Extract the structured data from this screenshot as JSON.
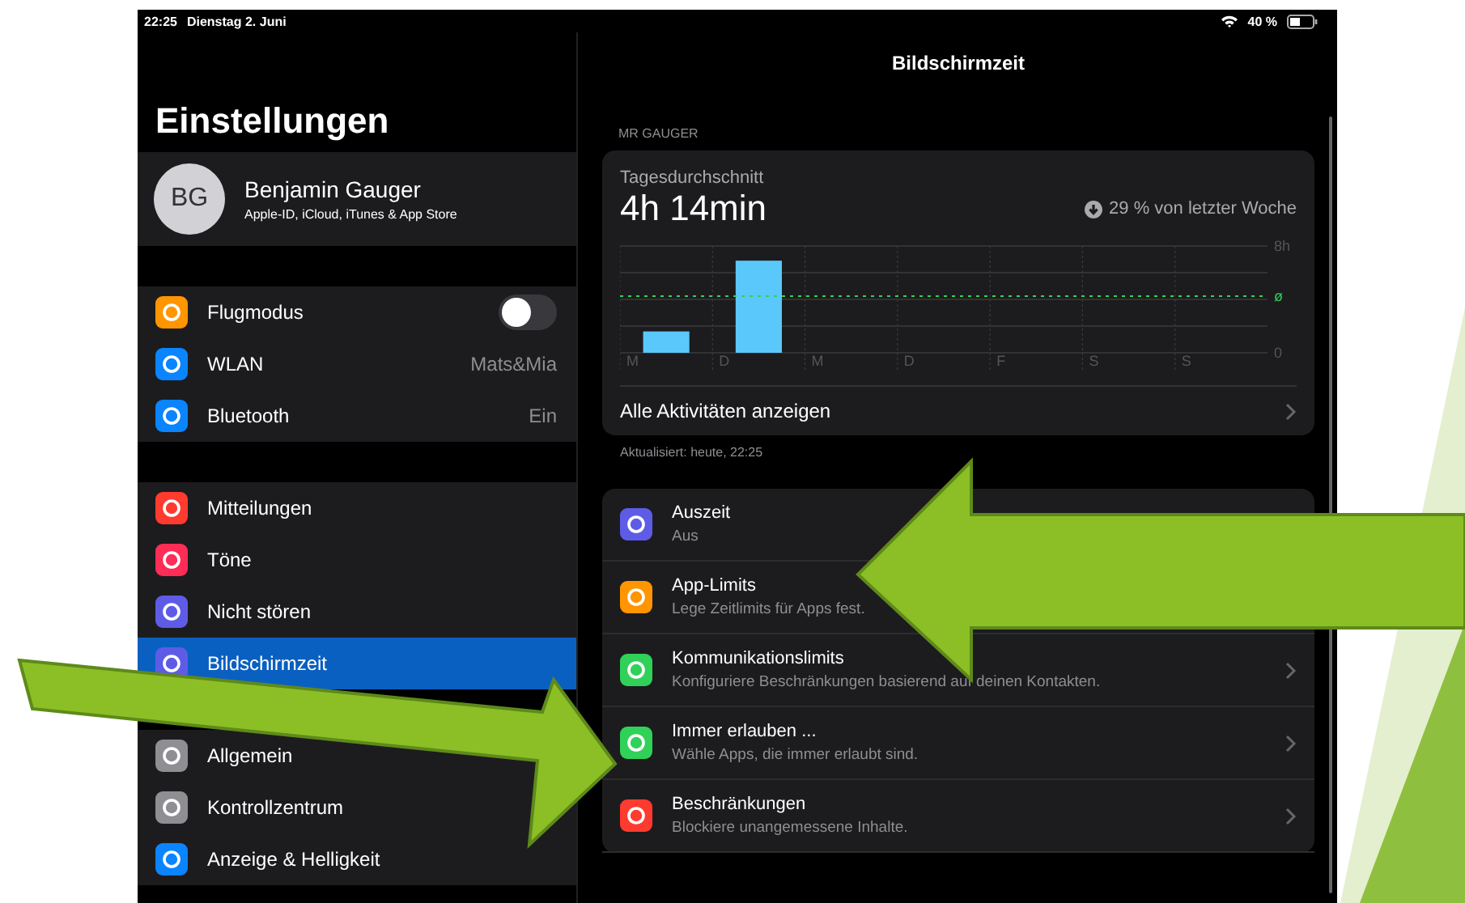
{
  "status_bar": {
    "time": "22:25",
    "date": "Dienstag 2. Juni",
    "battery": "40 %"
  },
  "sidebar": {
    "title": "Einstellungen",
    "profile": {
      "initials": "BG",
      "name": "Benjamin Gauger",
      "subtitle": "Apple-ID, iCloud, iTunes & App Store"
    },
    "groups": [
      {
        "items": [
          {
            "label": "Flugmodus",
            "color": "#ff9500",
            "kind": "toggle",
            "on": false,
            "selected": false
          },
          {
            "label": "WLAN",
            "color": "#0a84ff",
            "kind": "value",
            "value": "Mats&Mia",
            "selected": false
          },
          {
            "label": "Bluetooth",
            "color": "#0a84ff",
            "kind": "value",
            "value": "Ein",
            "selected": false
          }
        ]
      },
      {
        "items": [
          {
            "label": "Mitteilungen",
            "color": "#ff3b30",
            "kind": "plain",
            "selected": false
          },
          {
            "label": "Töne",
            "color": "#ff2d55",
            "kind": "plain",
            "selected": false
          },
          {
            "label": "Nicht stören",
            "color": "#5e5ce6",
            "kind": "plain",
            "selected": false
          },
          {
            "label": "Bildschirmzeit",
            "color": "#5e5ce6",
            "kind": "plain",
            "selected": true
          }
        ]
      },
      {
        "items": [
          {
            "label": "Allgemein",
            "color": "#8e8e93",
            "kind": "plain",
            "selected": false
          },
          {
            "label": "Kontrollzentrum",
            "color": "#8e8e93",
            "kind": "plain",
            "selected": false
          },
          {
            "label": "Anzeige & Helligkeit",
            "color": "#0a84ff",
            "kind": "plain",
            "selected": false
          }
        ]
      }
    ]
  },
  "detail": {
    "title": "Bildschirmzeit",
    "section_label": "MR GAUGER",
    "summary": {
      "label": "Tagesdurchschnitt",
      "total": "4h 14min",
      "trend": "29 % von letzter Woche",
      "chart_data": {
        "type": "bar",
        "categories": [
          "M",
          "D",
          "M",
          "D",
          "F",
          "S",
          "S"
        ],
        "values": [
          1.6,
          6.9,
          null,
          null,
          null,
          null,
          null
        ],
        "ylim": [
          0,
          8
        ],
        "yticks": [
          {
            "value": 0,
            "label": "0"
          },
          {
            "value": 8,
            "label": "8h"
          }
        ]
      },
      "average_mark": "ø",
      "link": "Alle Aktivitäten anzeigen"
    },
    "updated": "Aktualisiert: heute, 22:25",
    "options": [
      {
        "title": "Auszeit",
        "subtitle": "Aus",
        "color": "#5e5ce6"
      },
      {
        "title": "App-Limits",
        "subtitle": "Lege Zeitlimits für Apps fest.",
        "color": "#ff9500"
      },
      {
        "title": "Kommunikationslimits",
        "subtitle": "Konfiguriere Beschränkungen basierend auf deinen Kontakten.",
        "color": "#30d158"
      },
      {
        "title": "Immer erlauben ...",
        "subtitle": "Wähle Apps, die immer erlaubt sind.",
        "color": "#30d158"
      },
      {
        "title": "Beschränkungen",
        "subtitle": "Blockiere unangemessene Inhalte.",
        "color": "#ff3b30"
      }
    ]
  }
}
